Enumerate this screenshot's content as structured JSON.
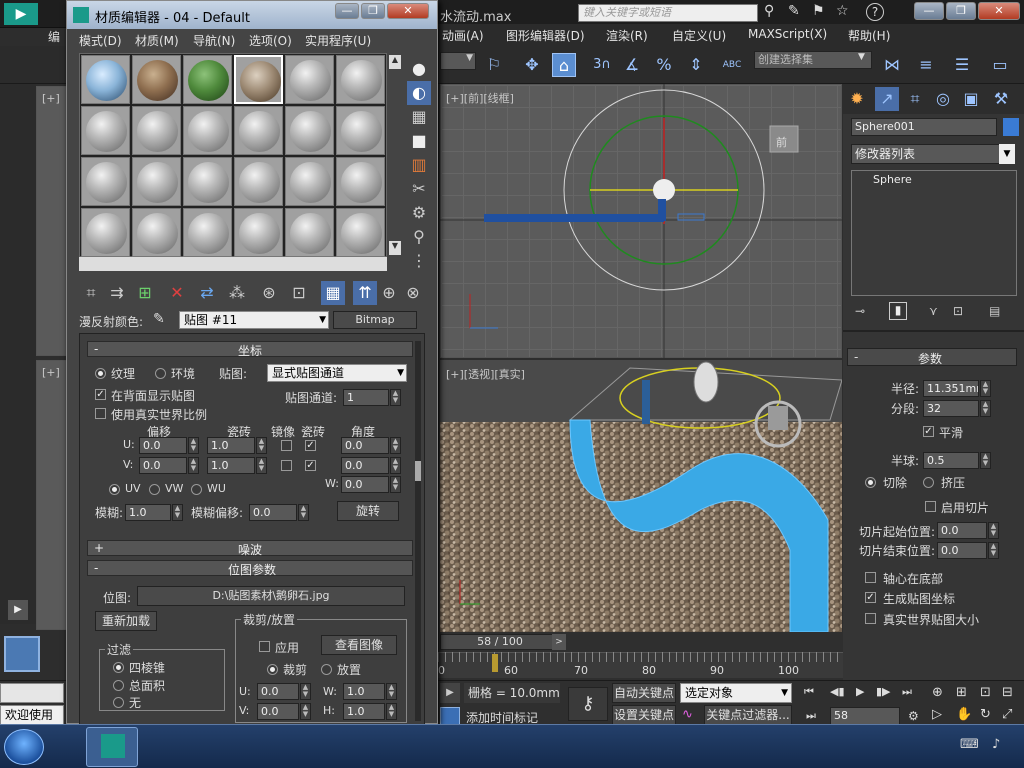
{
  "main_window": {
    "title_fragment": "水流动.max",
    "search_placeholder": "键入关键字或短语",
    "menu": [
      "动画(A)",
      "图形编辑器(D)",
      "渲染(R)",
      "自定义(U)",
      "MAXScript(X)",
      "帮助(H)"
    ],
    "left_menu_fragment": "编",
    "selection_set_placeholder": "创建选择集",
    "snap_labels": {
      "angle": "3",
      "percent": "%",
      "spinner": "ABC"
    }
  },
  "viewports": {
    "top_left_label": "[+]",
    "mid_left_label": "[+]",
    "front_label": "[+][前][线框]",
    "persp_label": "[+][透视][真实]",
    "front_cube": "前"
  },
  "material_editor": {
    "title": "材质编辑器 - 04 - Default",
    "menu": [
      "模式(D)",
      "材质(M)",
      "导航(N)",
      "选项(O)",
      "实用程序(U)"
    ],
    "diffuse_label": "漫反射颜色:",
    "map_name": "贴图 #11",
    "map_type": "Bitmap",
    "coords": {
      "header": "坐标",
      "texture": "纹理",
      "environ": "环境",
      "mapping_label": "贴图:",
      "mapping_value": "显式贴图通道",
      "show_back": "在背面显示贴图",
      "real_world": "使用真实世界比例",
      "channel_label": "贴图通道:",
      "channel_value": "1",
      "col_offset": "偏移",
      "col_tiling": "瓷砖",
      "col_mirror": "镜像",
      "col_tile": "瓷砖",
      "col_angle": "角度",
      "u_label": "U:",
      "v_label": "V:",
      "w_label": "W:",
      "u_offset": "0.0",
      "v_offset": "0.0",
      "u_tiling": "1.0",
      "v_tiling": "1.0",
      "u_angle": "0.0",
      "v_angle": "0.0",
      "w_angle": "0.0",
      "uv": "UV",
      "vw": "VW",
      "wu": "WU",
      "blur_label": "模糊:",
      "blur_value": "1.0",
      "blur_offset_label": "模糊偏移:",
      "blur_offset_value": "0.0",
      "rotate": "旋转"
    },
    "noise_header": "噪波",
    "bitmap_params": {
      "header": "位图参数",
      "bitmap_label": "位图:",
      "bitmap_path": "D:\\贴图素材\\鹅卵石.jpg",
      "reload": "重新加载",
      "filter_label": "过滤",
      "filter_options": [
        "四棱锥",
        "总面积",
        "无"
      ],
      "crop_label": "裁剪/放置",
      "apply": "应用",
      "view_image": "查看图像",
      "crop": "裁剪",
      "place": "放置",
      "u_label": "U:",
      "v_label": "V:",
      "w_label": "W:",
      "h_label": "H:",
      "u_value": "0.0",
      "v_value": "0.0",
      "w_value": "1.0",
      "h_value": "1.0"
    }
  },
  "command_panel": {
    "object_name": "Sphere001",
    "modifier_list": "修改器列表",
    "stack_item": "Sphere",
    "params_header": "参数",
    "radius_label": "半径:",
    "radius_value": "11.351mm",
    "segments_label": "分段:",
    "segments_value": "32",
    "smooth": "平滑",
    "hemisphere_label": "半球:",
    "hemisphere_value": "0.5",
    "chop": "切除",
    "squash": "挤压",
    "enable_slice": "启用切片",
    "slice_from_label": "切片起始位置:",
    "slice_from_value": "0.0",
    "slice_to_label": "切片结束位置:",
    "slice_to_value": "0.0",
    "base_to_pivot": "轴心在底部",
    "gen_mapping": "生成贴图坐标",
    "real_world": "真实世界贴图大小"
  },
  "timeline": {
    "frame_display": "58 / 100",
    "ticks": [
      "0",
      "60",
      "70",
      "80",
      "90",
      "100"
    ],
    "current_frame": 58,
    "total_frames": 100
  },
  "status": {
    "welcome": "欢迎使用",
    "grid": "栅格 = 10.0mm",
    "add_time_tag": "添加时间标记",
    "auto_key": "自动关键点",
    "set_key": "设置关键点",
    "selected_object": "选定对象",
    "key_filters": "关键点过滤器...",
    "frame_value": "58"
  },
  "colors": {
    "accent_blue": "#3a7bd5",
    "panel_bg": "#353535"
  }
}
